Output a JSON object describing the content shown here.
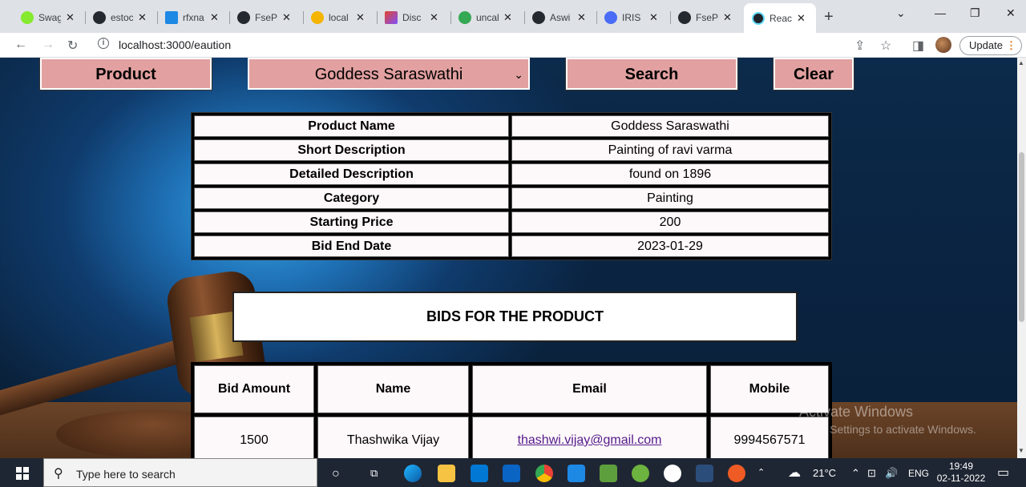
{
  "browser": {
    "tabs": [
      {
        "title": "Swag",
        "color": "#85ea2d"
      },
      {
        "title": "estoc",
        "color": "#24292f"
      },
      {
        "title": "rfxna",
        "color": "#1e88e5"
      },
      {
        "title": "FseP",
        "color": "#24292f"
      },
      {
        "title": "local",
        "color": "#f4b400"
      },
      {
        "title": "Disc",
        "color": "#e24329"
      },
      {
        "title": "uncal",
        "color": "#34a853"
      },
      {
        "title": "Aswi",
        "color": "#24292f"
      },
      {
        "title": "IRIS",
        "color": "#4a6cf7"
      },
      {
        "title": "FseP",
        "color": "#24292f"
      },
      {
        "title": "Reac",
        "color": "#61dafb"
      }
    ],
    "close_glyph": "✕",
    "new_tab_glyph": "+",
    "url": "localhost:3000/eaution",
    "update_label": "Update"
  },
  "search_bar": {
    "product_label": "Product",
    "selected_product": "Goddess Saraswathi",
    "search_label": "Search",
    "clear_label": "Clear"
  },
  "details": [
    {
      "key": "Product Name",
      "value": "Goddess Saraswathi"
    },
    {
      "key": "Short Description",
      "value": "Painting of ravi varma"
    },
    {
      "key": "Detailed Description",
      "value": "found on 1896"
    },
    {
      "key": "Category",
      "value": "Painting"
    },
    {
      "key": "Starting Price",
      "value": "200"
    },
    {
      "key": "Bid End Date",
      "value": "2023-01-29"
    }
  ],
  "bids": {
    "title": "BIDS FOR THE PRODUCT",
    "headers": [
      "Bid Amount",
      "Name",
      "Email",
      "Mobile"
    ],
    "rows": [
      {
        "amount": "1500",
        "name": "Thashwika Vijay",
        "email": "thashwi.vijay@gmail.com",
        "mobile": "9994567571"
      }
    ]
  },
  "watermark": {
    "line1": "Activate Windows",
    "line2": "Go to Settings to activate Windows."
  },
  "taskbar": {
    "search_placeholder": "Type here to search",
    "weather": "21°C",
    "language": "ENG",
    "time": "19:49",
    "date": "02-11-2022"
  }
}
